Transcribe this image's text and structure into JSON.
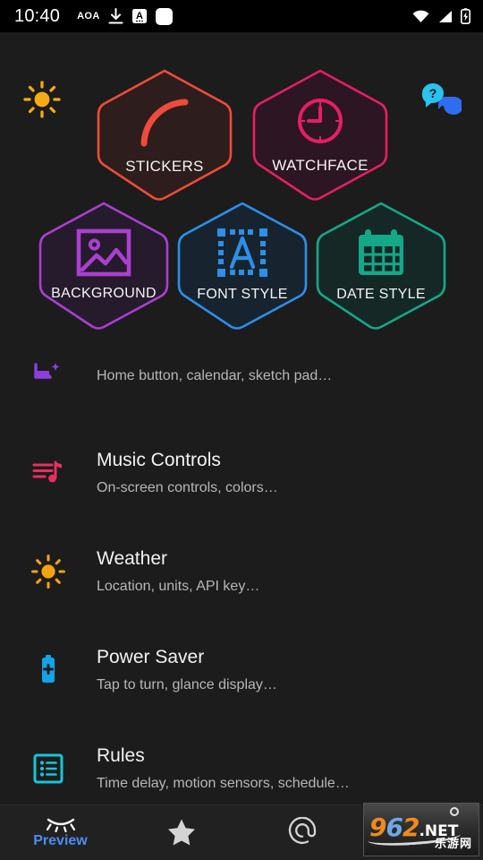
{
  "statusbar": {
    "time": "10:40",
    "aoa_label": "AOA",
    "icons": [
      "download-icon",
      "screenshot-icon",
      "rounded-square-icon",
      "wifi-icon",
      "signal-icon",
      "battery-charging-icon"
    ]
  },
  "overlay": {
    "sun_toggle_icon": "sun-icon",
    "help_icon": "help-chat-icon",
    "tiles": [
      {
        "label": "STICKERS",
        "icon": "arc-curve-icon",
        "color": "#ef4b3a",
        "fill": "#2d1d1c"
      },
      {
        "label": "WATCHFACE",
        "icon": "clock-icon",
        "color": "#e61e63",
        "fill": "#2c1623"
      },
      {
        "label": "BACKGROUND",
        "icon": "image-icon",
        "color": "#ab3fd0",
        "fill": "#251b2c"
      },
      {
        "label": "FONT STYLE",
        "icon": "font-select-icon",
        "color": "#2d8fe8",
        "fill": "#17242f"
      },
      {
        "label": "DATE STYLE",
        "icon": "calendar-icon",
        "color": "#14a888",
        "fill": "#152826"
      }
    ]
  },
  "list": {
    "rows": [
      {
        "title": "",
        "subtitle": "Home button, calendar, sketch pad…",
        "icon": "shortcut-icon",
        "icon_color": "#8c3fe0"
      },
      {
        "title": "Music Controls",
        "subtitle": "On-screen controls, colors…",
        "icon": "music-list-icon",
        "icon_color": "#e6305e"
      },
      {
        "title": "Weather",
        "subtitle": "Location, units, API key…",
        "icon": "sun-icon",
        "icon_color": "#f5a210"
      },
      {
        "title": "Power Saver",
        "subtitle": "Tap to turn, glance display…",
        "icon": "battery-plus-icon",
        "icon_color": "#13a3e8"
      },
      {
        "title": "Rules",
        "subtitle": "Time delay, motion sensors, schedule…",
        "icon": "rules-list-icon",
        "icon_color": "#17c5d6"
      }
    ]
  },
  "bottomnav": {
    "items": [
      {
        "label": "Preview",
        "icon": "closed-eye-icon",
        "active": true
      },
      {
        "label": "",
        "icon": "star-icon",
        "active": false
      },
      {
        "label": "",
        "icon": "at-icon",
        "active": false
      },
      {
        "label": "",
        "icon": "watermark-logo",
        "active": false
      }
    ],
    "active_color": "#4d8cf5"
  },
  "watermark": {
    "digit_9": "9",
    "digit_6": "6",
    "digit_2": "2",
    "net": ".NET",
    "cn_text": "乐游网"
  }
}
